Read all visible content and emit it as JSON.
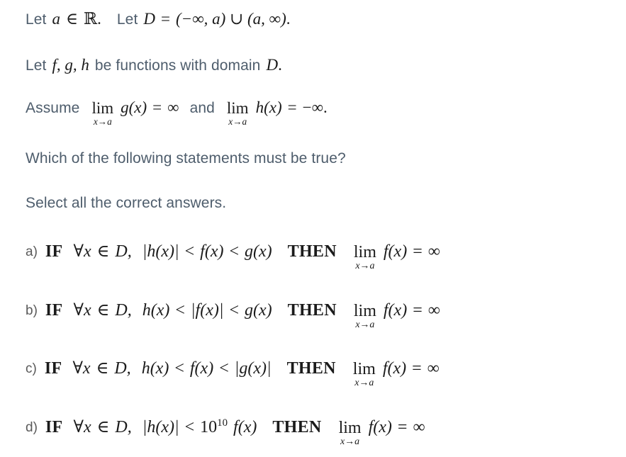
{
  "document": {
    "type": "math-multiple-choice-question",
    "background_color": "#ffffff",
    "prose_color": "#4e5d6c",
    "math_color": "#1b1b1b",
    "option_letter_color": "#5a5a5a"
  },
  "premises": {
    "line1": {
      "text_1": "Let",
      "math_1": "a",
      "math_in": "∈",
      "math_R": "ℝ",
      "math_period1": ".",
      "text_2": "Let",
      "math_D": "D",
      "math_eq": "=",
      "math_interval": "(−∞, a) ∪ (a, ∞)",
      "math_period2": "."
    },
    "line2": {
      "text_1": "Let",
      "math_fgh": "f, g, h",
      "text_2": "be functions with domain",
      "math_D": "D",
      "period": "."
    },
    "line3": {
      "text_1": "Assume",
      "lim_op": "lim",
      "lim_sub": "x→a",
      "math_g": "g(x)",
      "math_eq": "=",
      "math_inf": "∞",
      "text_2": "and",
      "lim_op_2": "lim",
      "lim_sub_2": "x→a",
      "math_h": "h(x)",
      "math_eq_2": "=",
      "math_neg_inf": "−∞",
      "period": "."
    }
  },
  "question": {
    "prompt": "Which of the following statements must be true?",
    "instruction": "Select all the correct answers."
  },
  "options": [
    {
      "letter": "a)",
      "if_keyword": "IF",
      "quantifier": "∀x",
      "member": "∈",
      "domain": "D,",
      "condition": "|h(x)| < f(x) < g(x)",
      "condition_parts": {
        "left": "|h(x)|",
        "rel1": "<",
        "middle": "f(x)",
        "rel2": "<",
        "right": "g(x)"
      },
      "then_keyword": "THEN",
      "lim_op": "lim",
      "lim_sub": "x→a",
      "conclusion_fn": "f(x)",
      "conclusion_eq": "=",
      "conclusion_val": "∞"
    },
    {
      "letter": "b)",
      "if_keyword": "IF",
      "quantifier": "∀x",
      "member": "∈",
      "domain": "D,",
      "condition": "h(x) < |f(x)| < g(x)",
      "condition_parts": {
        "left": "h(x)",
        "rel1": "<",
        "middle": "|f(x)|",
        "rel2": "<",
        "right": "g(x)"
      },
      "then_keyword": "THEN",
      "lim_op": "lim",
      "lim_sub": "x→a",
      "conclusion_fn": "f(x)",
      "conclusion_eq": "=",
      "conclusion_val": "∞"
    },
    {
      "letter": "c)",
      "if_keyword": "IF",
      "quantifier": "∀x",
      "member": "∈",
      "domain": "D,",
      "condition": "h(x) < f(x) < |g(x)|",
      "condition_parts": {
        "left": "h(x)",
        "rel1": "<",
        "middle": "f(x)",
        "rel2": "<",
        "right": "|g(x)|"
      },
      "then_keyword": "THEN",
      "lim_op": "lim",
      "lim_sub": "x→a",
      "conclusion_fn": "f(x)",
      "conclusion_eq": "=",
      "conclusion_val": "∞"
    },
    {
      "letter": "d)",
      "if_keyword": "IF",
      "quantifier": "∀x",
      "member": "∈",
      "domain": "D,",
      "condition": "|h(x)| < 10^10 f(x)",
      "condition_parts": {
        "left": "|h(x)|",
        "rel1": "<",
        "base": "10",
        "exponent": "10",
        "middle": "f(x)"
      },
      "then_keyword": "THEN",
      "lim_op": "lim",
      "lim_sub": "x→a",
      "conclusion_fn": "f(x)",
      "conclusion_eq": "=",
      "conclusion_val": "∞"
    }
  ]
}
